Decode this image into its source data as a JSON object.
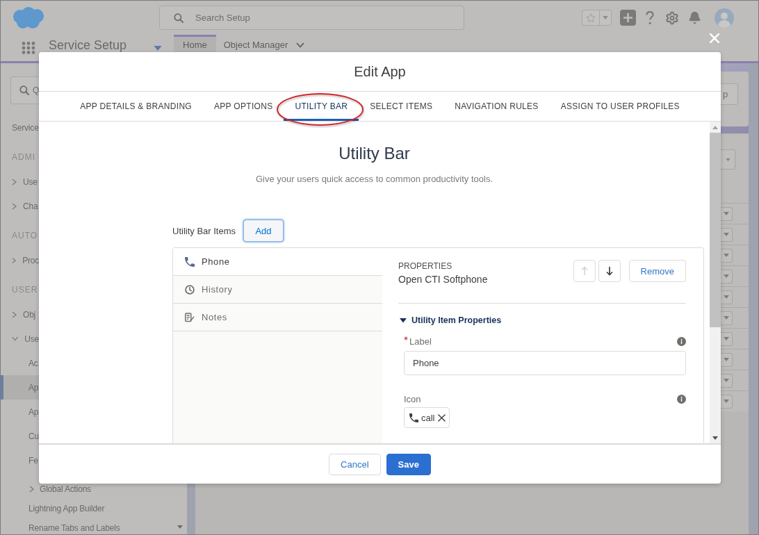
{
  "global_header": {
    "search": {
      "placeholder": "Search Setup"
    }
  },
  "app_nav": {
    "app_name": "Service Setup",
    "tabs": [
      {
        "label": "Home",
        "selected": true,
        "kind": "tab"
      },
      {
        "label": "Object Manager",
        "selected": false,
        "kind": "menu"
      }
    ]
  },
  "sidebar": {
    "quick_find": {
      "placeholder": "Q"
    },
    "items": [
      {
        "kind": "link",
        "label": "Service",
        "selected": false
      },
      {
        "kind": "heading",
        "label": "ADMI"
      },
      {
        "kind": "folder",
        "label": "Use",
        "expanded": false
      },
      {
        "kind": "folder",
        "label": "Cha",
        "expanded": false
      },
      {
        "kind": "heading",
        "label": "AUTO"
      },
      {
        "kind": "folder",
        "label": "Proc",
        "expanded": false
      },
      {
        "kind": "heading",
        "label": "USER"
      },
      {
        "kind": "folder",
        "label": "Obj",
        "expanded": false
      },
      {
        "kind": "folder",
        "label": "Use",
        "expanded": true,
        "children": [
          {
            "kind": "link",
            "label": "Ac",
            "selected": false
          },
          {
            "kind": "link",
            "label": "Ap",
            "selected": true
          },
          {
            "kind": "link",
            "label": "Ap",
            "selected": false
          },
          {
            "kind": "link",
            "label": "Cu",
            "selected": false
          },
          {
            "kind": "link",
            "label": "Fe",
            "selected": false
          },
          {
            "kind": "folder",
            "label": "Global Actions",
            "expanded": false
          },
          {
            "kind": "link",
            "label": "Lightning App Builder",
            "selected": false
          },
          {
            "kind": "link",
            "label": "Rename Tabs and Labels",
            "selected": false
          }
        ]
      }
    ]
  },
  "setup_page": {
    "header_button": {
      "label": "p"
    }
  },
  "modal": {
    "title": "Edit App",
    "tabs": [
      {
        "label": "APP DETAILS & BRANDING",
        "selected": false,
        "circled": false
      },
      {
        "label": "APP OPTIONS",
        "selected": false,
        "circled": false
      },
      {
        "label": "UTILITY BAR",
        "selected": true,
        "circled": true
      },
      {
        "label": "SELECT ITEMS",
        "selected": false,
        "circled": false
      },
      {
        "label": "NAVIGATION RULES",
        "selected": false,
        "circled": false
      },
      {
        "label": "ASSIGN TO USER PROFILES",
        "selected": false,
        "circled": false
      }
    ],
    "heading": "Utility Bar",
    "subheading": "Give your users quick access to common productivity tools.",
    "items_label": "Utility Bar Items",
    "add_button": {
      "label": "Add",
      "focused": true
    },
    "utility_items": [
      {
        "label": "Phone",
        "selected": true
      },
      {
        "label": "History",
        "selected": false
      },
      {
        "label": "Notes",
        "selected": false
      }
    ],
    "properties": {
      "eyebrow": "PROPERTIES",
      "name": "Open CTI Softphone",
      "move_up": {
        "disabled": true
      },
      "move_down": {
        "disabled": false
      },
      "remove_button": "Remove",
      "section": {
        "title": "Utility Item Properties",
        "expanded": true
      },
      "fields": [
        {
          "kind": "text",
          "label": "Label",
          "required": true,
          "value": "Phone"
        },
        {
          "kind": "icon_picker",
          "label": "Icon",
          "required": false,
          "value": "call"
        }
      ]
    },
    "footer_buttons": [
      {
        "label": "Cancel",
        "kind": "neutral"
      },
      {
        "label": "Save",
        "kind": "brand"
      }
    ]
  }
}
